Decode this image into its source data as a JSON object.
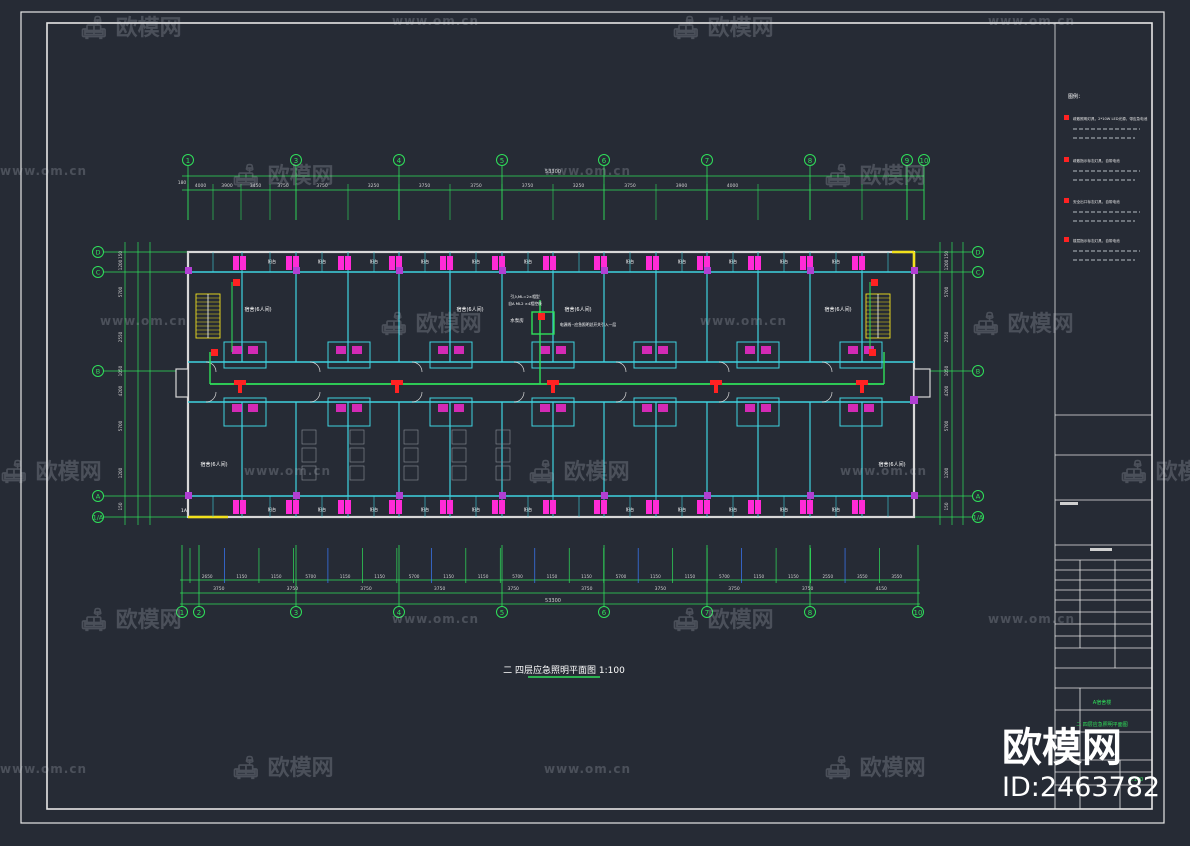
{
  "colors": {
    "background": "#262b35",
    "frame": "#e6e6e6",
    "wall": "#3fd3e0",
    "axis": "#2fe05a",
    "magenta": "#ff2bd6",
    "red": "#ff2222",
    "yellow": "#f2e21c",
    "dim_text": "#d0d0d0"
  },
  "drawing": {
    "title": "二 四层应急照明平面图 1:100",
    "total_dim": "53300",
    "top_axes": [
      "1",
      "3",
      "4",
      "5",
      "6",
      "7",
      "8",
      "9",
      "10"
    ],
    "bottom_axes": [
      "1",
      "2",
      "3",
      "4",
      "5",
      "6",
      "7",
      "8",
      "10"
    ],
    "left_axes": [
      "D",
      "C",
      "B",
      "A",
      "1/A"
    ],
    "right_axes": [
      "D",
      "C",
      "B",
      "A",
      "1/A"
    ],
    "top_dims": [
      "4000",
      "3900",
      "3450",
      "3750",
      "3750",
      "3250",
      "3750",
      "3750",
      "3750",
      "3250",
      "3750",
      "3900",
      "4000"
    ],
    "bottom_dims_row1": [
      "2650",
      "1150",
      "1150",
      "5700",
      "1150",
      "1150",
      "5700",
      "1150",
      "1150",
      "5700",
      "1150",
      "1150",
      "5700",
      "1150",
      "1150",
      "5700",
      "1150",
      "1150",
      "2550",
      "3550",
      "3550"
    ],
    "bottom_dims_row2": [
      "3750",
      "3750",
      "3750",
      "3750",
      "3750",
      "3750",
      "3750",
      "3750",
      "3750",
      "4150"
    ],
    "left_dims": [
      "150",
      "1200",
      "5700",
      "2550",
      "1050",
      "4200",
      "5700",
      "1200",
      "150"
    ],
    "room_label_top": "宿舍(6人间)",
    "room_label_bottom": "宿舍(6人间)",
    "balcony_label": "阳台",
    "pump_label": "水泵房",
    "note_1": "引入ML=2×相型\n自A ML2 ×4相控线",
    "note_2": "电源线~应急照明总开关引入一层",
    "sheet_no": "1A"
  },
  "legend": {
    "title": "图例：",
    "items": [
      "疏散照明灯具，2*10W LED光源，带应急电池",
      "疏散指示标志灯具，自带电池",
      "安全出口标志灯具，自带电池",
      "楼层指示标志灯具，自带电池"
    ]
  },
  "title_block": {
    "project": "A宿舍楼",
    "drawing_name": "二 四层应急照明平面图",
    "scale": "1:100"
  },
  "watermark": {
    "logo": "欧模网",
    "url": "www.om.cn",
    "brand": "欧模网",
    "id": "ID:2463782"
  }
}
